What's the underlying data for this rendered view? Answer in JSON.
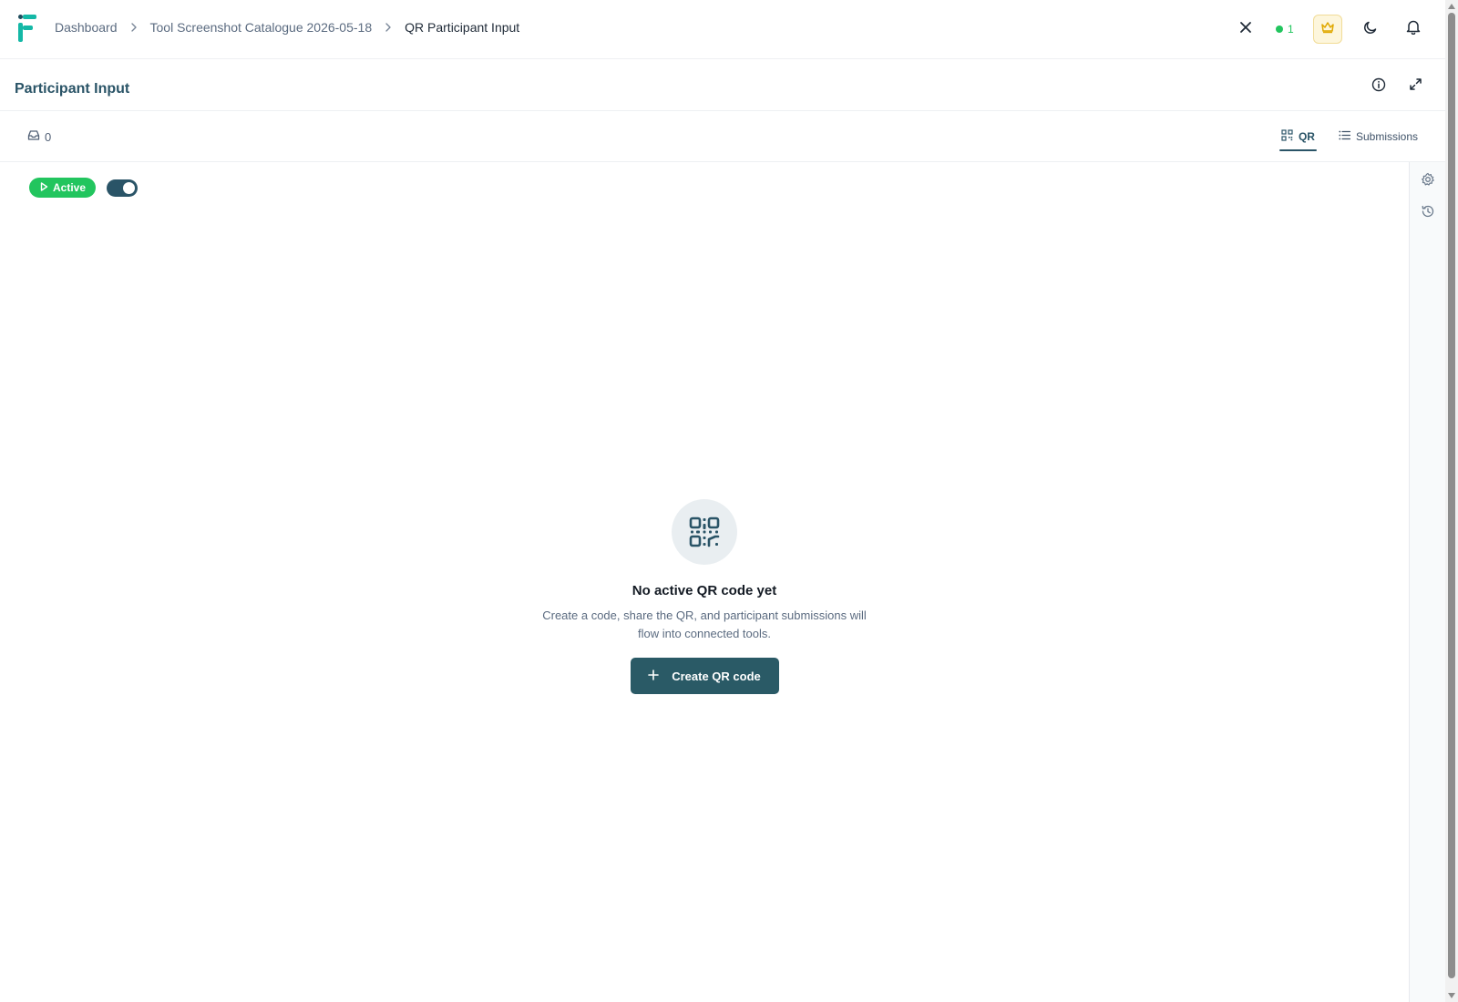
{
  "colors": {
    "brand_teal": "#14b8a6",
    "primary": "#2a5467",
    "active_green": "#22c55e",
    "crown_bg": "#fdf6dc",
    "crown_icon": "#e0a800"
  },
  "header": {
    "logo_icon": "brand-logo",
    "breadcrumb": [
      {
        "label": "Dashboard"
      },
      {
        "label": "Tool Screenshot Catalogue 2026-05-18"
      },
      {
        "label": "QR Participant Input"
      }
    ],
    "presence_count": "1",
    "icons": [
      "close-icon",
      "crown-icon",
      "moon-icon",
      "bell-icon"
    ]
  },
  "panel": {
    "title": "Participant Input",
    "icons": [
      "info-icon",
      "expand-icon"
    ]
  },
  "toolbar": {
    "inbox_count": "0",
    "tabs": [
      {
        "label": "QR",
        "icon": "qr-icon",
        "active": true
      },
      {
        "label": "Submissions",
        "icon": "list-icon",
        "active": false
      }
    ]
  },
  "status": {
    "badge_label": "Active",
    "toggle_on": true
  },
  "right_rail": {
    "icons": [
      "settings-icon",
      "history-icon"
    ]
  },
  "empty_state": {
    "title": "No active QR code yet",
    "description": "Create a code, share the QR, and participant submissions will flow into connected tools.",
    "button_label": "Create QR code"
  }
}
